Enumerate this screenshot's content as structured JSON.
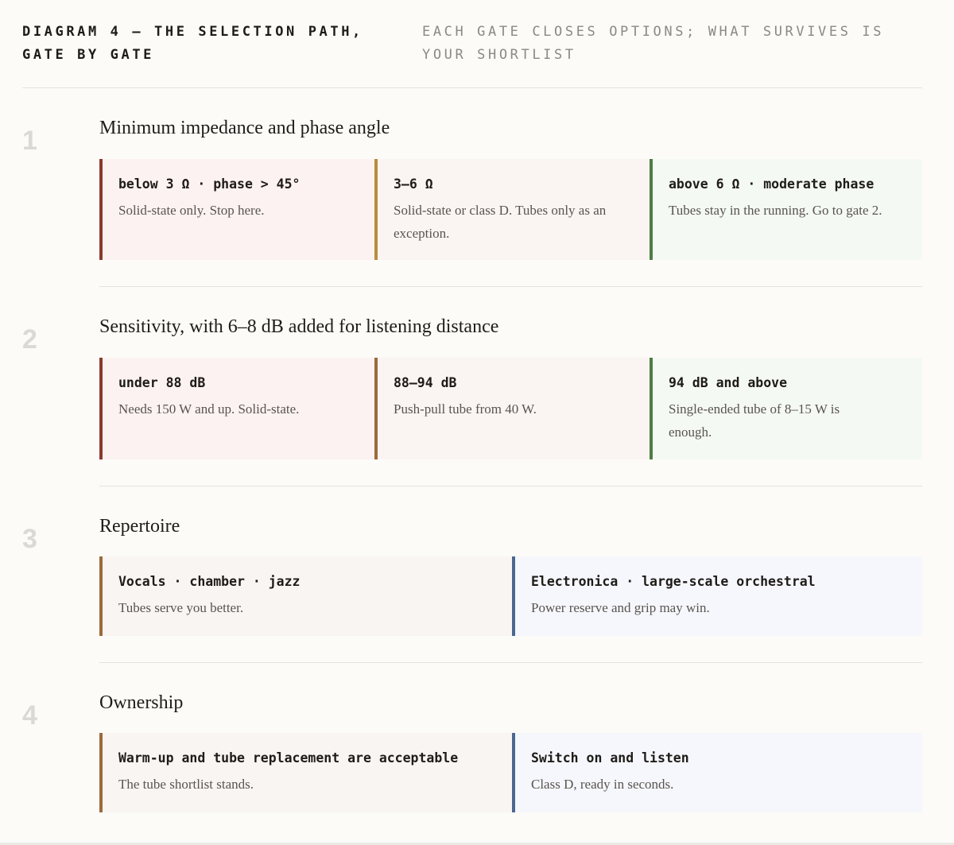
{
  "header": {
    "title": "Diagram 4 — the selection path, gate by gate",
    "subtitle": "Each gate closes options; what survives is your shortlist"
  },
  "colors": {
    "red": "#8b3a2e",
    "amber": "#b98d3e",
    "brown": "#9c6b3a",
    "green": "#4e7d45",
    "blue": "#4b678f",
    "bg_red": "#fbf2f1",
    "bg_warm": "#faf5f2",
    "bg_green": "#f4f9f3",
    "bg_neutral": "#f8f5f3",
    "bg_blue": "#f5f7fc"
  },
  "gates": [
    {
      "number": "1",
      "title": "Minimum impedance and phase angle",
      "options": [
        {
          "label": "below 3 Ω · phase > 45°",
          "desc": "Solid-state only. Stop here.",
          "tone": "red"
        },
        {
          "label": "3–6 Ω",
          "desc": "Solid-state or class D. Tubes only as an exception.",
          "tone": "amber"
        },
        {
          "label": "above 6 Ω · moderate phase",
          "desc": "Tubes stay in the running. Go to gate 2.",
          "tone": "green"
        }
      ]
    },
    {
      "number": "2",
      "title": "Sensitivity, with 6–8 dB added for listening distance",
      "options": [
        {
          "label": "under 88 dB",
          "desc": "Needs 150 W and up. Solid-state.",
          "tone": "red"
        },
        {
          "label": "88–94 dB",
          "desc": "Push-pull tube from 40 W.",
          "tone": "brown"
        },
        {
          "label": "94 dB and above",
          "desc": "Single-ended tube of 8–15 W is enough.",
          "tone": "green"
        }
      ]
    },
    {
      "number": "3",
      "title": "Repertoire",
      "options": [
        {
          "label": "Vocals · chamber · jazz",
          "desc": "Tubes serve you better.",
          "tone": "brown"
        },
        {
          "label": "Electronica · large-scale orchestral",
          "desc": "Power reserve and grip may win.",
          "tone": "blue"
        }
      ]
    },
    {
      "number": "4",
      "title": "Ownership",
      "options": [
        {
          "label": "Warm-up and tube replacement are acceptable",
          "desc": "The tube shortlist stands.",
          "tone": "brown"
        },
        {
          "label": "Switch on and listen",
          "desc": "Class D, ready in seconds.",
          "tone": "blue"
        }
      ]
    }
  ]
}
